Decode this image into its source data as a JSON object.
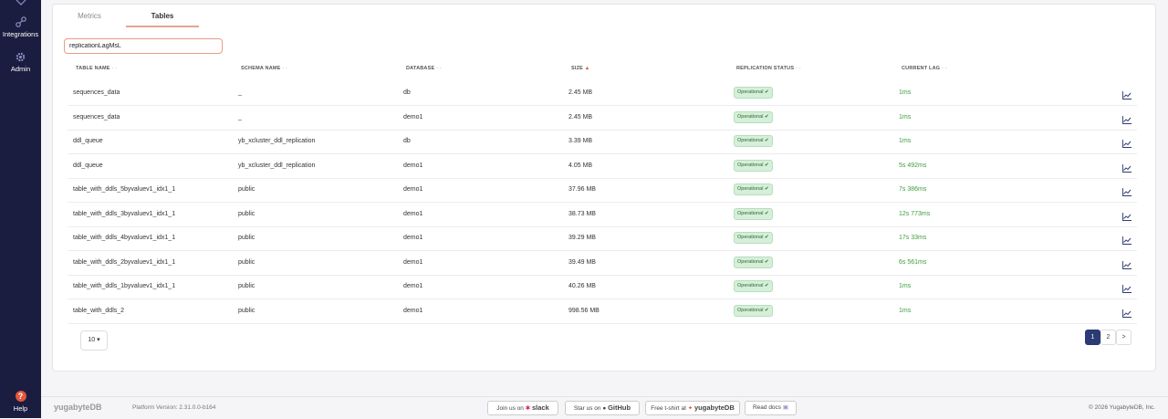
{
  "sidebar": {
    "items": [
      {
        "label": "Integrations",
        "icon": "integrations-icon"
      },
      {
        "label": "Admin",
        "icon": "gear-icon"
      }
    ],
    "help": {
      "label": "Help",
      "glyph": "?"
    }
  },
  "tabs": [
    {
      "label": "Metrics",
      "active": false
    },
    {
      "label": "Tables",
      "active": true
    }
  ],
  "search": {
    "value": "replicationLagMsL"
  },
  "table": {
    "headers": [
      {
        "label": "TABLE NAME",
        "sort": "- -"
      },
      {
        "label": "SCHEMA NAME",
        "sort": "- -"
      },
      {
        "label": "DATABASE",
        "sort": "- -"
      },
      {
        "label": "SIZE",
        "sort": "▲"
      },
      {
        "label": "REPLICATION STATUS",
        "sort": "- -"
      },
      {
        "label": "CURRENT LAG",
        "sort": "- -"
      }
    ],
    "rows": [
      {
        "table": "sequences_data",
        "schema": "_",
        "database": "db",
        "size": "2.45 MB",
        "status": "Operational ✔",
        "lag": "1ms"
      },
      {
        "table": "sequences_data",
        "schema": "_",
        "database": "demo1",
        "size": "2.45 MB",
        "status": "Operational ✔",
        "lag": "1ms"
      },
      {
        "table": "ddl_queue",
        "schema": "yb_xcluster_ddl_replication",
        "database": "db",
        "size": "3.39 MB",
        "status": "Operational ✔",
        "lag": "1ms"
      },
      {
        "table": "ddl_queue",
        "schema": "yb_xcluster_ddl_replication",
        "database": "demo1",
        "size": "4.05 MB",
        "status": "Operational ✔",
        "lag": "5s 492ms"
      },
      {
        "table": "table_with_ddls_5byvaluev1_idx1_1",
        "schema": "public",
        "database": "demo1",
        "size": "37.96 MB",
        "status": "Operational ✔",
        "lag": "7s 386ms"
      },
      {
        "table": "table_with_ddls_3byvaluev1_idx1_1",
        "schema": "public",
        "database": "demo1",
        "size": "38.73 MB",
        "status": "Operational ✔",
        "lag": "12s 773ms"
      },
      {
        "table": "table_with_ddls_4byvaluev1_idx1_1",
        "schema": "public",
        "database": "demo1",
        "size": "39.29 MB",
        "status": "Operational ✔",
        "lag": "17s 33ms"
      },
      {
        "table": "table_with_ddls_2byvaluev1_idx1_1",
        "schema": "public",
        "database": "demo1",
        "size": "39.49 MB",
        "status": "Operational ✔",
        "lag": "6s 561ms"
      },
      {
        "table": "table_with_ddls_1byvaluev1_idx1_1",
        "schema": "public",
        "database": "demo1",
        "size": "40.26 MB",
        "status": "Operational ✔",
        "lag": "1ms"
      },
      {
        "table": "table_with_ddls_2",
        "schema": "public",
        "database": "demo1",
        "size": "998.56 MB",
        "status": "Operational ✔",
        "lag": "1ms"
      }
    ]
  },
  "pagination": {
    "page_size": "10 ▾",
    "pages": [
      "1",
      "2"
    ],
    "next": ">",
    "current": "1"
  },
  "footer": {
    "logo": "yugabyteDB",
    "version": "Platform Version: 2.31.0.0-b164",
    "slack_prefix": "Join us on",
    "slack_name": "slack",
    "github_prefix": "Star us on",
    "github_name": "GitHub",
    "tshirt_prefix": "Free t-shirt at",
    "tshirt_name": "yugabyteDB",
    "docs": "Read docs",
    "copyright": "© 2026 YugabyteDB, Inc."
  },
  "colors": {
    "sidebar": "#1a1d3f",
    "accent": "#e8a48f",
    "status_green": "#3e9c3e",
    "active_page": "#2b3b73"
  }
}
